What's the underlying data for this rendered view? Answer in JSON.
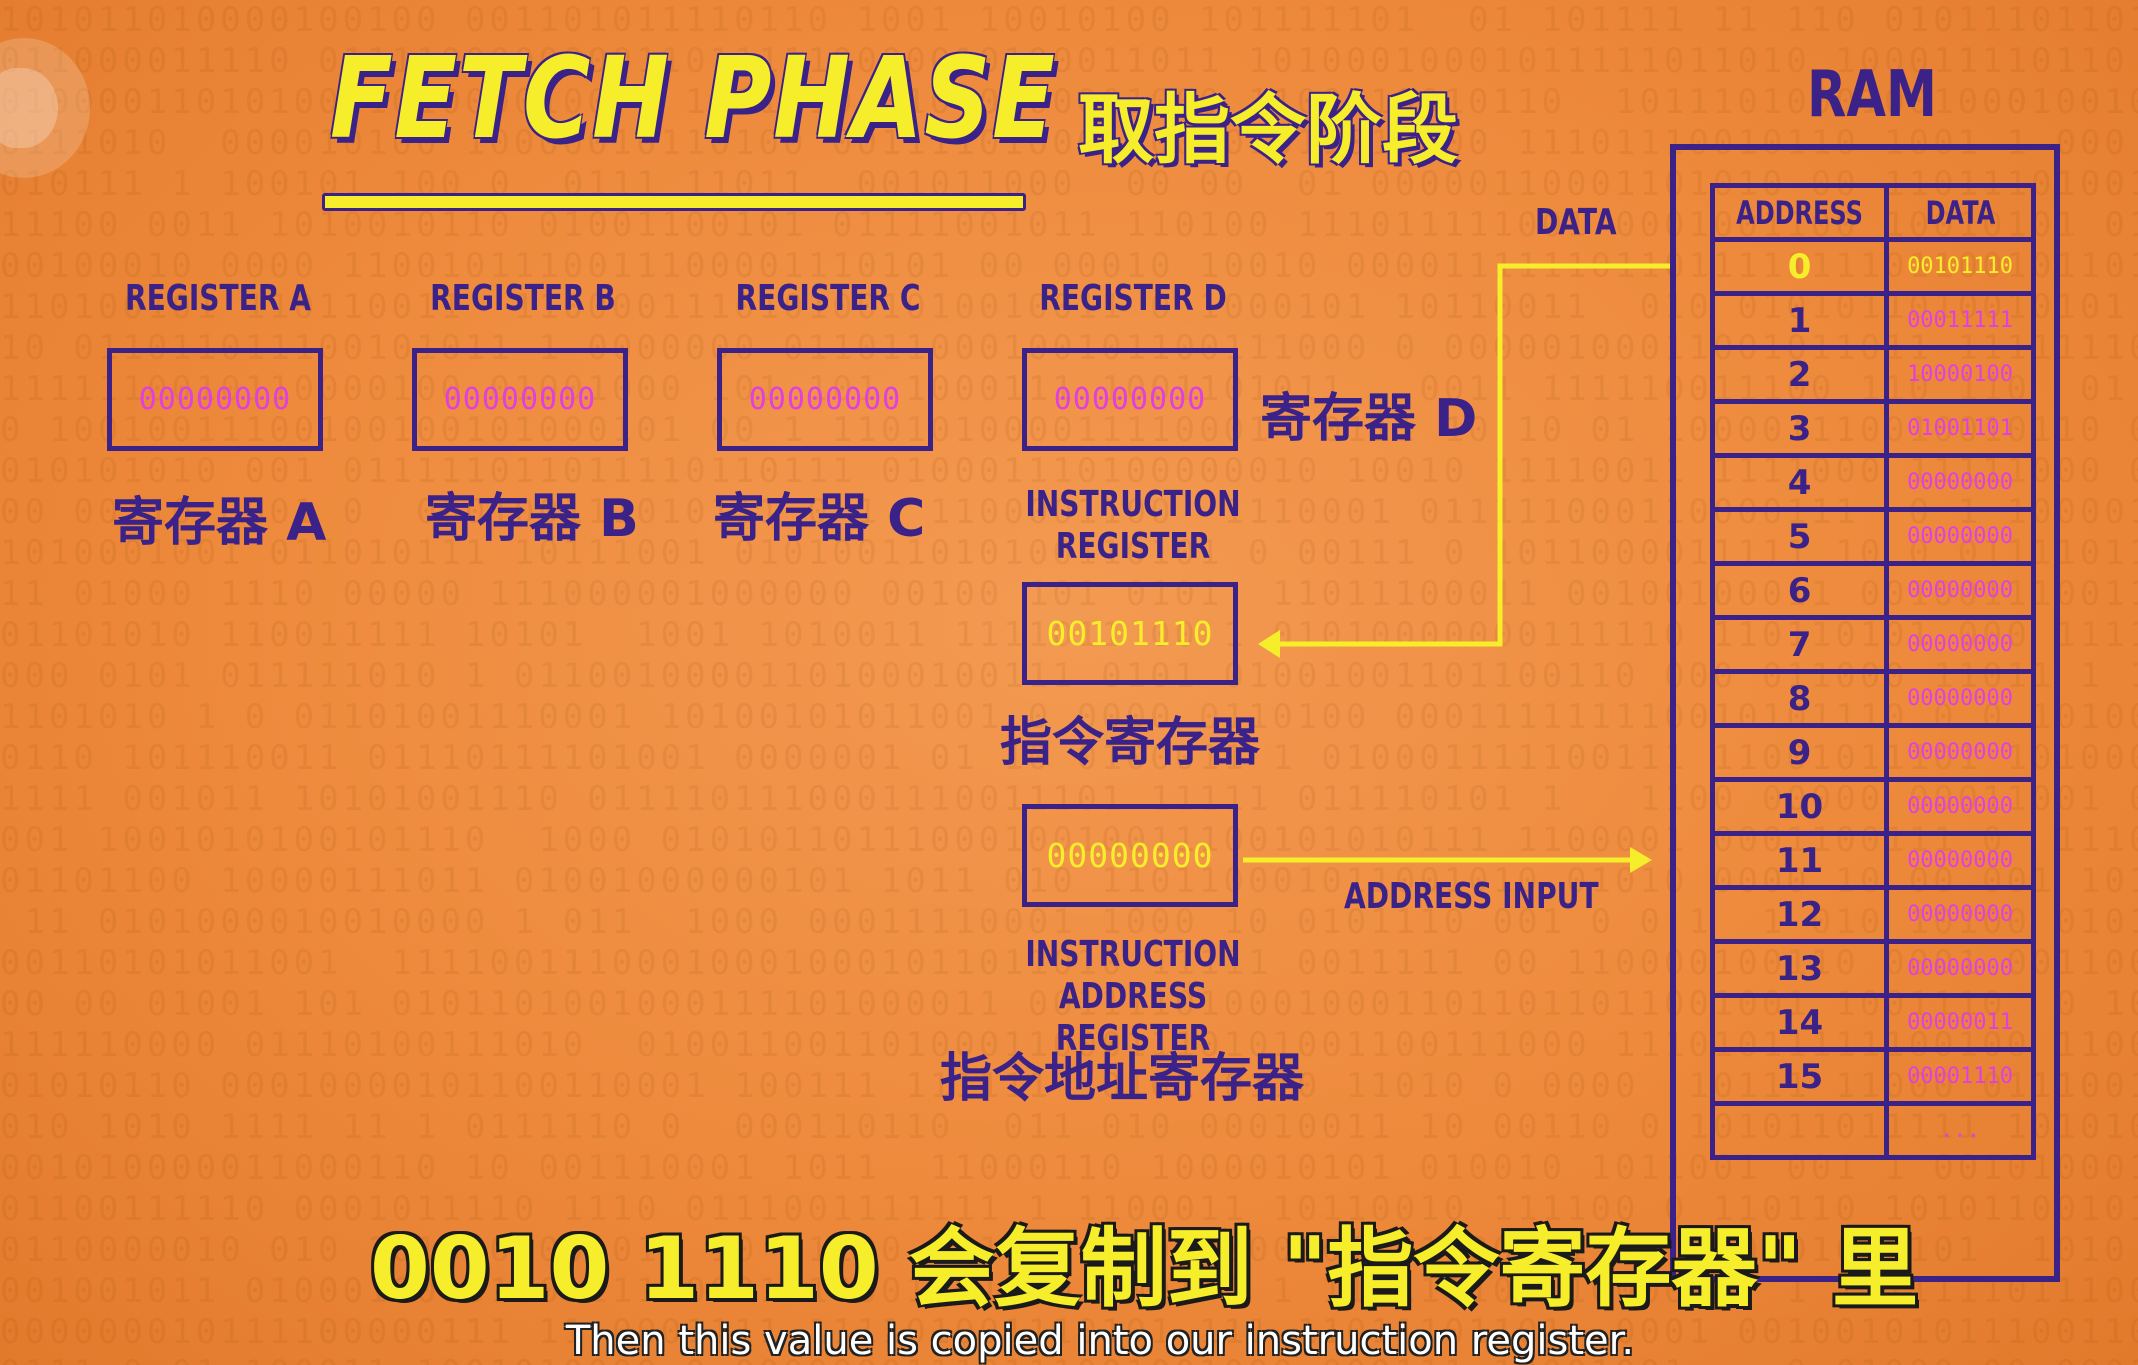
{
  "title": "FETCH PHASE",
  "title_zh": "取指令阶段",
  "registers": [
    {
      "label": "REGISTER A",
      "value": "00000000",
      "label_zh": "寄存器 A"
    },
    {
      "label": "REGISTER B",
      "value": "00000000",
      "label_zh": "寄存器 B"
    },
    {
      "label": "REGISTER C",
      "value": "00000000",
      "label_zh": "寄存器 C"
    },
    {
      "label": "REGISTER D",
      "value": "00000000",
      "label_zh": "寄存器 D"
    }
  ],
  "instruction_register": {
    "label_line1": "INSTRUCTION",
    "label_line2": "REGISTER",
    "value": "00101110",
    "label_zh": "指令寄存器"
  },
  "instruction_address_register": {
    "label_line1": "INSTRUCTION",
    "label_line2": "ADDRESS REGISTER",
    "value": "00000000",
    "label_zh": "指令地址寄存器"
  },
  "wires": {
    "data_label": "DATA",
    "address_label": "ADDRESS INPUT"
  },
  "ram": {
    "title": "RAM",
    "col_address": "ADDRESS",
    "col_data": "DATA",
    "rows": [
      {
        "address": "0",
        "data": "00101110",
        "highlight": true
      },
      {
        "address": "1",
        "data": "00011111"
      },
      {
        "address": "2",
        "data": "10000100"
      },
      {
        "address": "3",
        "data": "01001101"
      },
      {
        "address": "4",
        "data": "00000000"
      },
      {
        "address": "5",
        "data": "00000000"
      },
      {
        "address": "6",
        "data": "00000000"
      },
      {
        "address": "7",
        "data": "00000000"
      },
      {
        "address": "8",
        "data": "00000000"
      },
      {
        "address": "9",
        "data": "00000000"
      },
      {
        "address": "10",
        "data": "00000000"
      },
      {
        "address": "11",
        "data": "00000000"
      },
      {
        "address": "12",
        "data": "00000000"
      },
      {
        "address": "13",
        "data": "00000000"
      },
      {
        "address": "14",
        "data": "00000011"
      },
      {
        "address": "15",
        "data": "00001110"
      },
      {
        "address": "",
        "data": "..."
      }
    ]
  },
  "subtitles": {
    "zh": "0010 1110 会复制到 \"指令寄存器\" 里",
    "en": "Then this value is copied into our instruction register."
  },
  "colors": {
    "background": "#ee8a3c",
    "primary": "#3b2288",
    "accent_yellow": "#f6ee2a",
    "data_magenta": "#e040e0"
  }
}
